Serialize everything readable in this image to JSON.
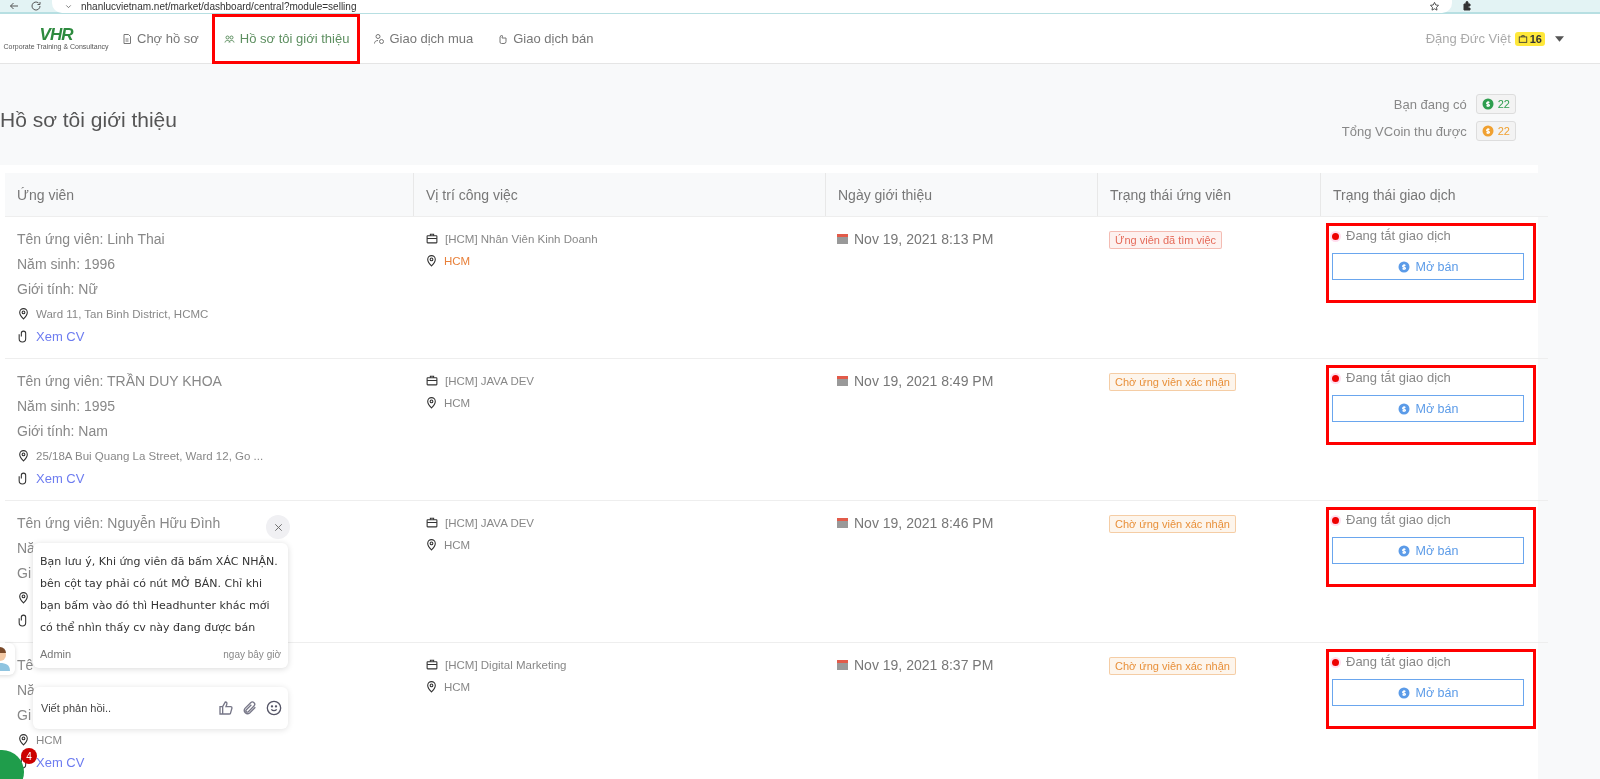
{
  "browser": {
    "url": "nhanlucvietnam.net/market/dashboard/central?module=selling"
  },
  "navbar": {
    "logo": {
      "text": "VHR",
      "tagline": "Corporate Training & Consultancy"
    },
    "items": [
      {
        "label": "Chợ hồ sơ",
        "kind": "market",
        "selected": false,
        "highlighted": false
      },
      {
        "label": "Hồ sơ tôi giới thiệu",
        "kind": "referred",
        "selected": true,
        "highlighted": true
      },
      {
        "label": "Giao dịch mua",
        "kind": "buy",
        "selected": false,
        "highlighted": false
      },
      {
        "label": "Giao dịch bán",
        "kind": "sell",
        "selected": false,
        "highlighted": false
      }
    ],
    "user": {
      "name": "Đặng Đức Việt",
      "badge": "16"
    }
  },
  "page_title": "Hồ sơ tôi giới thiệu",
  "balances": [
    {
      "label": "Bạn đang có",
      "value": "22",
      "color": "#2e9e4f"
    },
    {
      "label": "Tổng VCoin thu được",
      "value": "22",
      "color": "#f0a030"
    }
  ],
  "table": {
    "columns": [
      "Ứng viên",
      "Vị trí công việc",
      "Ngày giới thiệu",
      "Trạng thái ứng viên",
      "Trạng thái giao dịch"
    ],
    "rows": [
      {
        "candidate": [
          {
            "kind": "field",
            "label": "Tên ứng viên:",
            "value": "Linh Thai"
          },
          {
            "kind": "field",
            "label": "Năm sinh:",
            "value": "1996"
          },
          {
            "kind": "field",
            "label": "Giới tính:",
            "value": "Nữ"
          },
          {
            "kind": "address",
            "text": "Ward 11, Tan Binh District, HCMC"
          },
          {
            "kind": "cv",
            "text": "Xem CV"
          }
        ],
        "job": "[HCM] Nhân Viên Kinh Doanh",
        "location": {
          "text": "HCM",
          "color": "#e8803a"
        },
        "date": "Nov 19, 2021 8:13 PM",
        "status": {
          "text": "Ứng viên đã tìm việc",
          "color": "#e56b5a"
        },
        "deal": {
          "state": "Đang tắt giao dịch",
          "button": "Mở bán"
        },
        "highlighted": true
      },
      {
        "candidate": [
          {
            "kind": "field",
            "label": "Tên ứng viên:",
            "value": "TRẦN DUY KHOA"
          },
          {
            "kind": "field",
            "label": "Năm sinh:",
            "value": "1995"
          },
          {
            "kind": "field",
            "label": "Giới tính:",
            "value": "Nam"
          },
          {
            "kind": "address",
            "text": "25/18A Bui Quang La Street, Ward 12, Go ..."
          },
          {
            "kind": "cv",
            "text": "Xem CV"
          }
        ],
        "job": "[HCM] JAVA DEV",
        "location": {
          "text": "HCM",
          "color": "#888888"
        },
        "date": "Nov 19, 2021 8:49 PM",
        "status": {
          "text": "Chờ ứng viên xác nhận",
          "color": "#e8903a"
        },
        "deal": {
          "state": "Đang tắt giao dịch",
          "button": "Mở bán"
        },
        "highlighted": true
      },
      {
        "candidate": [
          {
            "kind": "field",
            "label": "Tên ứng viên:",
            "value": "Nguyễn Hữu Đình"
          },
          {
            "kind": "field",
            "label": "Nă"
          },
          {
            "kind": "field",
            "label": "Gi"
          },
          {
            "kind": "address"
          },
          {
            "kind": "cv"
          }
        ],
        "job": "[HCM] JAVA DEV",
        "location": {
          "text": "HCM",
          "color": "#888888"
        },
        "date": "Nov 19, 2021 8:46 PM",
        "status": {
          "text": "Chờ ứng viên xác nhận",
          "color": "#e8903a"
        },
        "deal": {
          "state": "Đang tắt giao dịch",
          "button": "Mở bán"
        },
        "highlighted": true
      },
      {
        "candidate": [
          {
            "kind": "field",
            "label": "Tê"
          },
          {
            "kind": "field",
            "label": "Nă"
          },
          {
            "kind": "field",
            "label": "Gi"
          },
          {
            "kind": "address",
            "text": "HCM"
          },
          {
            "kind": "cv",
            "text": "Xem CV"
          }
        ],
        "job": "[HCM] Digital Marketing",
        "location": {
          "text": "HCM",
          "color": "#888888"
        },
        "date": "Nov 19, 2021 8:37 PM",
        "status": {
          "text": "Chờ ứng viên xác nhận",
          "color": "#e8903a"
        },
        "deal": {
          "state": "Đang tắt giao dịch",
          "button": "Mở bán"
        },
        "highlighted": true
      }
    ]
  },
  "chat": {
    "message": "Bạn lưu ý, Khi ứng viên đã bấm XÁC NHẬN. bên cột tay phải có nút MỞ BÁN. Chỉ khi bạn bấm vào đó thì Headhunter khác mới có thể nhìn thấy cv này đang được bán",
    "sender": "Admin",
    "time": "ngay bây giờ",
    "reply_placeholder": "Viết phản hồi..",
    "unread": "4"
  }
}
